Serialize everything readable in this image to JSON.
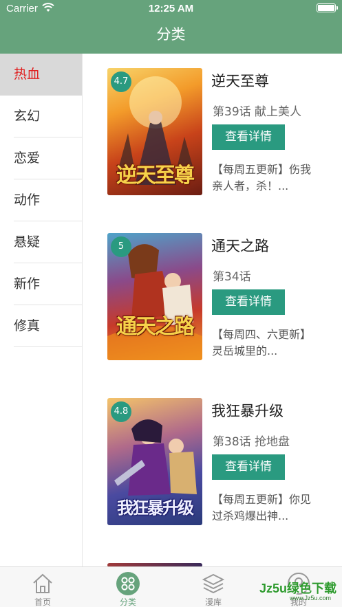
{
  "status": {
    "carrier": "Carrier",
    "time": "12:25 AM"
  },
  "nav": {
    "title": "分类"
  },
  "sidebar": {
    "items": [
      {
        "label": "热血",
        "active": true
      },
      {
        "label": "玄幻"
      },
      {
        "label": "恋爱"
      },
      {
        "label": "动作"
      },
      {
        "label": "悬疑"
      },
      {
        "label": "新作"
      },
      {
        "label": "修真"
      }
    ]
  },
  "comics": [
    {
      "rating": "4.7",
      "title": "逆天至尊",
      "episode": "第39话 献上美人",
      "button": "查看详情",
      "desc": "【每周五更新】伤我亲人者，杀！...",
      "cover_text": "逆天至尊"
    },
    {
      "rating": "5",
      "title": "通天之路",
      "episode": "第34话",
      "button": "查看详情",
      "desc": "【每周四、六更新】灵岳城里的...",
      "cover_text": "通天之路"
    },
    {
      "rating": "4.8",
      "title": "我狂暴升级",
      "episode": "第38话 抢地盘",
      "button": "查看详情",
      "desc": "【每周五更新】你见过杀鸡爆出神...",
      "cover_text": "我狂暴升级"
    }
  ],
  "tabbar": {
    "items": [
      {
        "label": "首页",
        "icon": "home-icon"
      },
      {
        "label": "分类",
        "icon": "category-icon",
        "active": true
      },
      {
        "label": "漫库",
        "icon": "layers-icon"
      },
      {
        "label": "我的",
        "icon": "profile-icon"
      }
    ]
  },
  "watermark": {
    "text": "Jz5u绿色下载",
    "url": "www.Jz5u.com"
  },
  "colors": {
    "header": "#66a37c",
    "accent": "#2a9a80",
    "active_category": "#e02020"
  }
}
